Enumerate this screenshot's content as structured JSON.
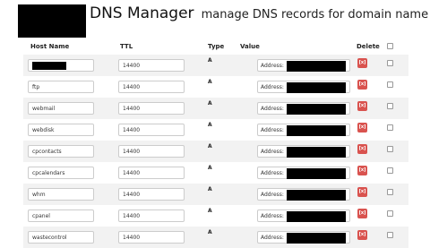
{
  "header": {
    "title": "DNS Manager",
    "subtitle": "manage DNS records for domain name"
  },
  "table": {
    "columns": {
      "host": "Host Name",
      "ttl": "TTL",
      "type": "Type",
      "value": "Value",
      "delete": "Delete"
    },
    "value_prefix": "Address:",
    "delete_label": "[x]",
    "rows": [
      {
        "host": "",
        "ttl": "14400",
        "type": "A"
      },
      {
        "host": "ftp",
        "ttl": "14400",
        "type": "A"
      },
      {
        "host": "webmail",
        "ttl": "14400",
        "type": "A"
      },
      {
        "host": "webdisk",
        "ttl": "14400",
        "type": "A"
      },
      {
        "host": "cpcontacts",
        "ttl": "14400",
        "type": "A"
      },
      {
        "host": "cpcalendars",
        "ttl": "14400",
        "type": "A"
      },
      {
        "host": "whm",
        "ttl": "14400",
        "type": "A"
      },
      {
        "host": "cpanel",
        "ttl": "14400",
        "type": "A"
      },
      {
        "host": "wastecontrol",
        "ttl": "14400",
        "type": "A"
      }
    ]
  }
}
